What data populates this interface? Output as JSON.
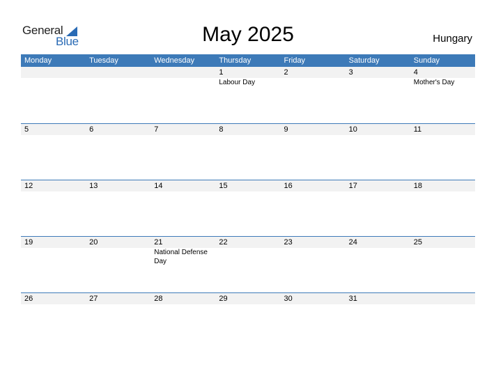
{
  "logo": {
    "general": "General",
    "blue": "Blue"
  },
  "title": "May 2025",
  "country": "Hungary",
  "colors": {
    "header_bg": "#3d7ab8",
    "date_row_bg": "#f2f2f2",
    "logo_blue": "#2a6bb5"
  },
  "weekdays": [
    "Monday",
    "Tuesday",
    "Wednesday",
    "Thursday",
    "Friday",
    "Saturday",
    "Sunday"
  ],
  "weeks": [
    {
      "days": [
        "",
        "",
        "",
        "1",
        "2",
        "3",
        "4"
      ],
      "events": [
        "",
        "",
        "",
        "Labour Day",
        "",
        "",
        "Mother's Day"
      ]
    },
    {
      "days": [
        "5",
        "6",
        "7",
        "8",
        "9",
        "10",
        "11"
      ],
      "events": [
        "",
        "",
        "",
        "",
        "",
        "",
        ""
      ]
    },
    {
      "days": [
        "12",
        "13",
        "14",
        "15",
        "16",
        "17",
        "18"
      ],
      "events": [
        "",
        "",
        "",
        "",
        "",
        "",
        ""
      ]
    },
    {
      "days": [
        "19",
        "20",
        "21",
        "22",
        "23",
        "24",
        "25"
      ],
      "events": [
        "",
        "",
        "National Defense Day",
        "",
        "",
        "",
        ""
      ]
    },
    {
      "days": [
        "26",
        "27",
        "28",
        "29",
        "30",
        "31",
        ""
      ],
      "events": [
        "",
        "",
        "",
        "",
        "",
        "",
        ""
      ]
    }
  ]
}
